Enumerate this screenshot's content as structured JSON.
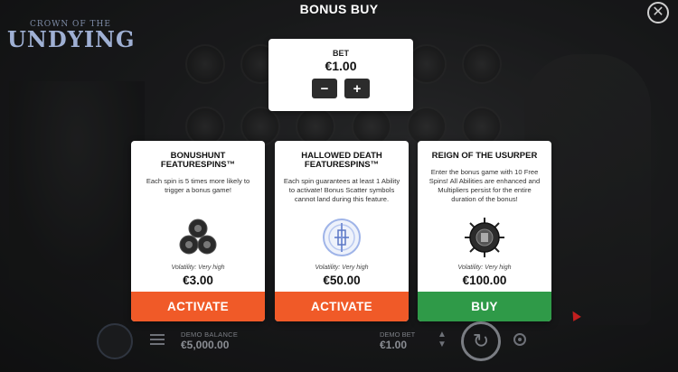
{
  "game": {
    "logo_top": "CROWN OF THE",
    "logo_main": "UNDYING"
  },
  "modal": {
    "title": "BONUS BUY",
    "close_icon": "close-icon"
  },
  "bet": {
    "label": "BET",
    "value": "€1.00",
    "decrease_label": "−",
    "increase_label": "+"
  },
  "cards": [
    {
      "title": "BONUSHUNT FEATURESPINS™",
      "description": "Each spin is 5 times more likely to trigger a bonus game!",
      "icon": "triple-orb-icon",
      "volatility": "Volatility: Very high",
      "price": "€3.00",
      "action": "ACTIVATE",
      "action_color": "#f05a28"
    },
    {
      "title": "HALLOWED DEATH FEATURESPINS™",
      "description": "Each spin guarantees at least 1 Ability to activate! Bonus Scatter symbols cannot land during this feature.",
      "icon": "hallowed-sigil-icon",
      "volatility": "Volatility: Very high",
      "price": "€50.00",
      "action": "ACTIVATE",
      "action_color": "#f05a28"
    },
    {
      "title": "REIGN OF THE USURPER",
      "description": "Enter the bonus game with 10 Free Spins! All Abilities are enhanced and Multipliers persist for the entire duration of the bonus!",
      "icon": "spiked-crown-orb-icon",
      "volatility": "Volatility: Very high",
      "price": "€100.00",
      "action": "BUY",
      "action_color": "#2f9a48"
    }
  ],
  "bottom_bar": {
    "balance_label": "DEMO BALANCE",
    "balance_value": "€5,000.00",
    "bet_label": "DEMO BET",
    "bet_value": "€1.00"
  }
}
